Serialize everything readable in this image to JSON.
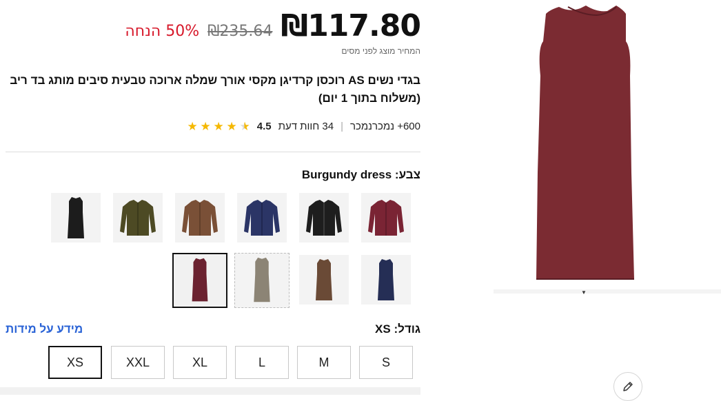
{
  "price": {
    "current": "₪117.80",
    "original": "₪235.64",
    "discount": "50% הנחה",
    "tax_note": "המחיר מוצג לפני מסים"
  },
  "product": {
    "title": "בגדי נשים AS רוכסן קרדיגן מקסי אורך שמלה ארוכה טבעית סיבים מותג בד ריב (משלוח בתוך 1 יום)"
  },
  "rating": {
    "value": "4.5",
    "stars": 4.5,
    "reviews": "34 חוות דעת",
    "sold": "600+ נמכרנמכר"
  },
  "color": {
    "label": "צבע:",
    "selected": "Burgundy dress",
    "swatches": [
      {
        "name": "burgundy-cardigan",
        "color": "#7a2434"
      },
      {
        "name": "black-cardigan",
        "color": "#1e1e1e"
      },
      {
        "name": "navy-cardigan",
        "color": "#2b3566"
      },
      {
        "name": "brown-cardigan",
        "color": "#7a5037"
      },
      {
        "name": "olive-cardigan",
        "color": "#4d4a24"
      },
      {
        "name": "black-dress",
        "color": "#1c1c1c"
      },
      {
        "name": "navy-dress",
        "color": "#252e55"
      },
      {
        "name": "brown-dress",
        "color": "#6a4a36"
      },
      {
        "name": "gray-dress",
        "color": "#8c8475"
      },
      {
        "name": "burgundy-dress",
        "color": "#6b2230"
      }
    ]
  },
  "size": {
    "label": "גודל:",
    "selected": "XS",
    "guide": "מידע על מידות",
    "options": [
      "S",
      "M",
      "L",
      "XL",
      "XXL",
      "XS"
    ]
  },
  "colors": {
    "accent": "#d7182a",
    "link": "#2a63d6",
    "star": "#f5b800",
    "dress": "#7b2b32"
  }
}
